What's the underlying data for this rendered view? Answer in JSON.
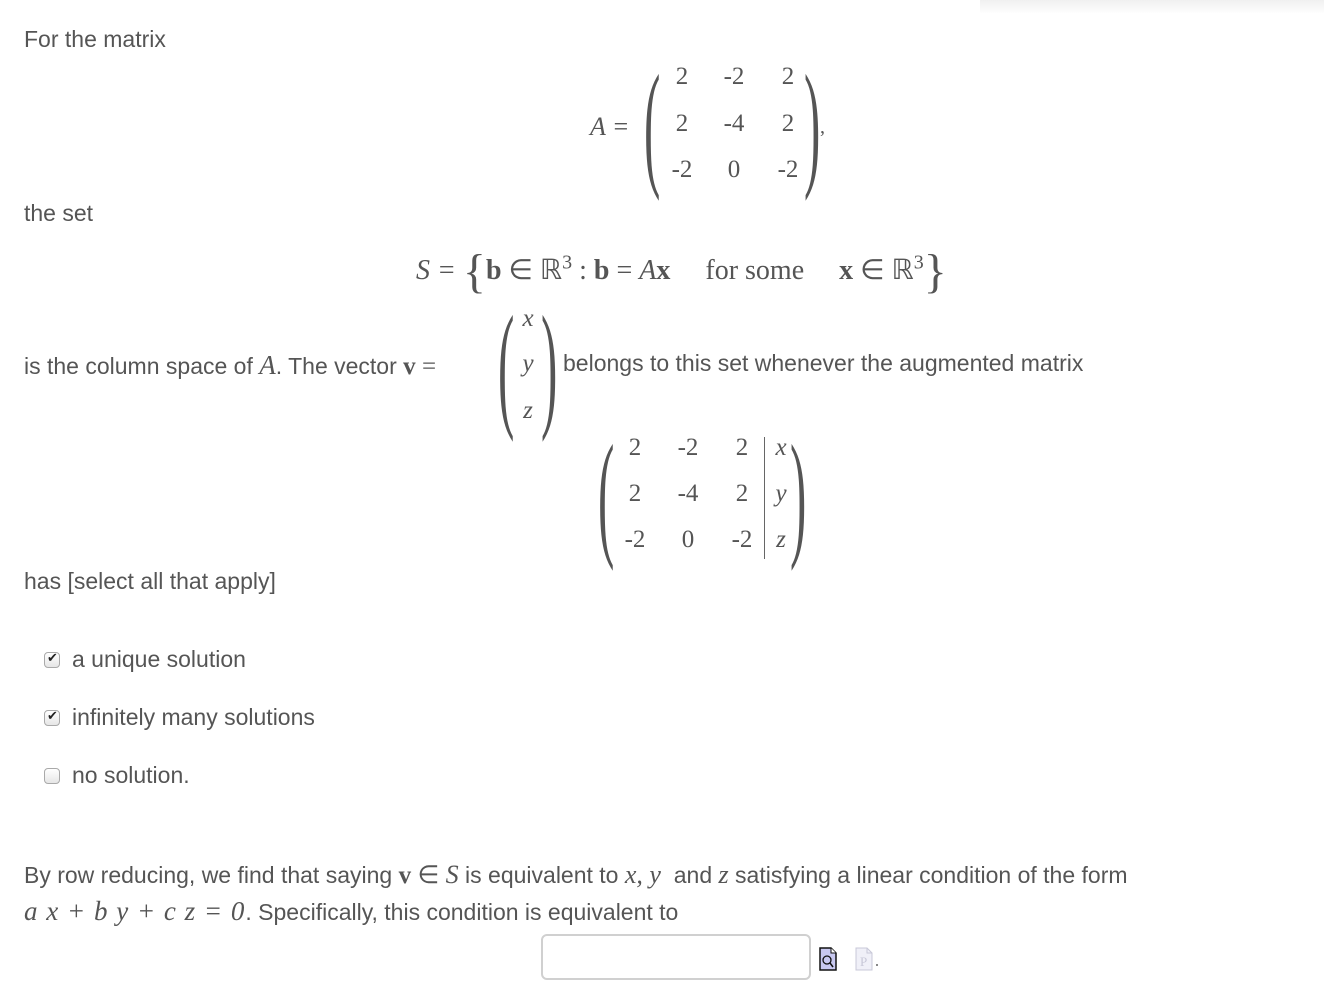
{
  "intro": "For the matrix",
  "matrix_A": {
    "label": "A =",
    "rows": [
      [
        "2",
        "-2",
        "2"
      ],
      [
        "2",
        "-4",
        "2"
      ],
      [
        "-2",
        "0",
        "-2"
      ]
    ],
    "trailing": ","
  },
  "the_set": "the set",
  "set_def": {
    "lhs": "S =",
    "open": "{",
    "b": "b",
    "in": "∈",
    "R": "ℝ",
    "exp": "3",
    "colon": ":",
    "eq": "=",
    "A": "A",
    "x": "x",
    "for_some": "for some",
    "close": "}"
  },
  "column_space_text": "is the column space of",
  "column_space_A": "A",
  "vector_text": ". The vector",
  "vector_v": "v",
  "vector_eq": "=",
  "vector_entries": [
    "x",
    "y",
    "z"
  ],
  "belongs_text": "belongs to this set whenever the augmented matrix",
  "augmented": {
    "rows": [
      [
        "2",
        "-2",
        "2",
        "x"
      ],
      [
        "2",
        "-4",
        "2",
        "y"
      ],
      [
        "-2",
        "0",
        "-2",
        "z"
      ]
    ]
  },
  "has_text": "has [select all that apply]",
  "options": [
    {
      "label": "a unique solution",
      "checked": true
    },
    {
      "label": "infinitely many solutions",
      "checked": true
    },
    {
      "label": "no solution.",
      "checked": false
    }
  ],
  "conclusion": {
    "line1_a": "By row reducing, we find that saying",
    "v": "v",
    "in": "∈",
    "S": "S",
    "line1_b": "is equivalent to",
    "xy": "x, y",
    "and": "and",
    "z": "z",
    "line1_c": "satisfying a linear condition of the form",
    "formula": "a x + b y + c z = 0",
    "line2": ". Specifically, this condition is equivalent to"
  },
  "answer": {
    "value": "",
    "placeholder": ""
  },
  "icons": {
    "preview": "preview-icon",
    "format": "format-help-icon"
  }
}
